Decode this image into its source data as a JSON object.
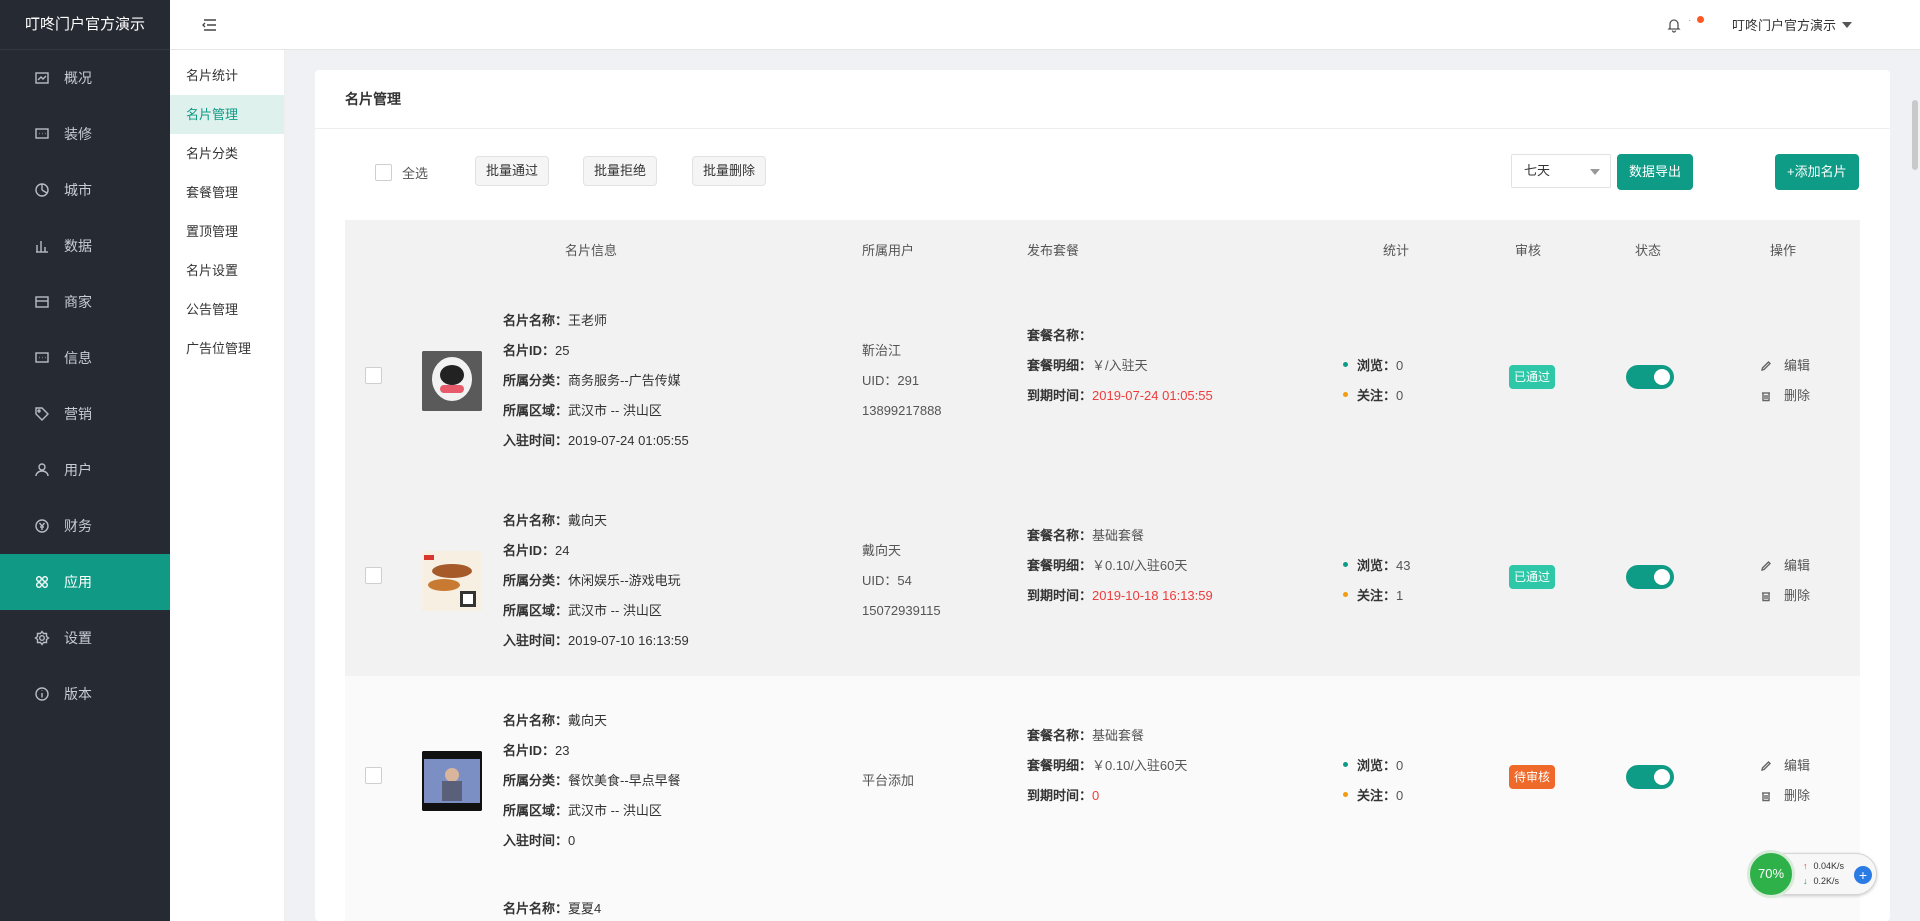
{
  "brand": "叮咚门户官方演示",
  "sidebar": {
    "items": [
      {
        "label": "概况",
        "icon": "dashboard-icon"
      },
      {
        "label": "装修",
        "icon": "chat-icon"
      },
      {
        "label": "城市",
        "icon": "pie-icon"
      },
      {
        "label": "数据",
        "icon": "bar-chart-icon"
      },
      {
        "label": "商家",
        "icon": "store-icon"
      },
      {
        "label": "信息",
        "icon": "message-icon"
      },
      {
        "label": "营销",
        "icon": "tag-icon"
      },
      {
        "label": "用户",
        "icon": "user-icon"
      },
      {
        "label": "财务",
        "icon": "yen-icon"
      },
      {
        "label": "应用",
        "icon": "apps-icon"
      },
      {
        "label": "设置",
        "icon": "gear-icon"
      },
      {
        "label": "版本",
        "icon": "info-icon"
      }
    ],
    "active_index": 9
  },
  "subnav": {
    "items": [
      "名片统计",
      "名片管理",
      "名片分类",
      "套餐管理",
      "置顶管理",
      "名片设置",
      "公告管理",
      "广告位管理"
    ],
    "active_index": 1
  },
  "header": {
    "user_name": "叮咚门户官方演示",
    "separator": "·"
  },
  "card": {
    "title": "名片管理"
  },
  "toolbar": {
    "select_all": "全选",
    "batch_approve": "批量通过",
    "batch_reject": "批量拒绝",
    "batch_delete": "批量删除",
    "period": "七天",
    "export": "数据导出",
    "add": "+添加名片"
  },
  "table": {
    "headers": {
      "info": "名片信息",
      "user": "所属用户",
      "plan": "发布套餐",
      "stats": "统计",
      "review": "审核",
      "status": "状态",
      "ops": "操作"
    },
    "labels": {
      "name": "名片名称：",
      "id": "名片ID：",
      "category": "所属分类：",
      "region": "所属区域：",
      "joined": "入驻时间：",
      "plan_name": "套餐名称：",
      "plan_detail": "套餐明细：",
      "expire": "到期时间：",
      "views": "浏览：",
      "follows": "关注：",
      "edit": "编辑",
      "delete": "删除"
    },
    "rows": [
      {
        "name": "王老师",
        "id": "25",
        "category": "商务服务--广告传媒",
        "region": "武汉市 -- 洪山区",
        "joined": "2019-07-24 01:05:55",
        "user_lines": [
          "靳治江",
          "UID：291",
          "13899217888"
        ],
        "plan_name": "",
        "plan_detail": "￥/入驻天",
        "expire": "2019-07-24 01:05:55",
        "views": "0",
        "follows": "0",
        "review": "已通过",
        "review_color": "#2ec7a8",
        "enabled": true
      },
      {
        "name": "戴向天",
        "id": "24",
        "category": "休闲娱乐--游戏电玩",
        "region": "武汉市 -- 洪山区",
        "joined": "2019-07-10 16:13:59",
        "user_lines": [
          "戴向天",
          "UID：54",
          "15072939115"
        ],
        "plan_name": "基础套餐",
        "plan_detail": "￥0.10/入驻60天",
        "expire": "2019-10-18 16:13:59",
        "views": "43",
        "follows": "1",
        "review": "已通过",
        "review_color": "#2ec7a8",
        "enabled": true
      },
      {
        "name": "戴向天",
        "id": "23",
        "category": "餐饮美食--早点早餐",
        "region": "武汉市 -- 洪山区",
        "joined": "0",
        "user_lines": [
          "平台添加"
        ],
        "plan_name": "基础套餐",
        "plan_detail": "￥0.10/入驻60天",
        "expire": "0",
        "views": "0",
        "follows": "0",
        "review": "待审核",
        "review_color": "#ef6a2a",
        "enabled": true
      },
      {
        "name": "夏夏4"
      }
    ]
  },
  "colors": {
    "accent": "#0f9c86",
    "sidebar_bg": "#262a33",
    "red": "#ef3b3b",
    "views_dot": "#0f9c86",
    "follows_dot": "#f39c12"
  },
  "netwidget": {
    "percent": "70%",
    "up_rate": "0.04K/s",
    "down_rate": "0.2K/s"
  }
}
